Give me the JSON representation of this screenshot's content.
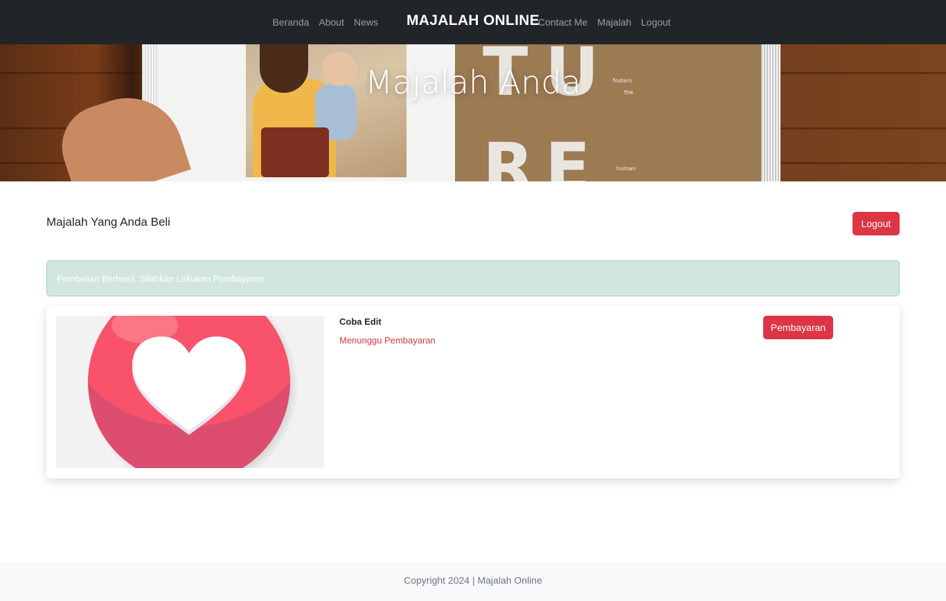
{
  "nav": {
    "left_links": [
      "Beranda",
      "About",
      "News"
    ],
    "brand": "MAJALAH ONLINE",
    "right_links": [
      "Contact Me",
      "Majalah",
      "Logout"
    ]
  },
  "hero": {
    "title": "Majalah Anda",
    "magazine_letters": [
      "T",
      "U",
      "R",
      "E"
    ],
    "magazine_words": [
      "fosters",
      "the",
      "human"
    ]
  },
  "main": {
    "section_title": "Majalah Yang Anda Beli",
    "logout_label": "Logout",
    "alert_text": "Pembelian Berhasil, Silahkan Lakukan Pembayaran",
    "card": {
      "title": "Coba Edit",
      "status": "Menunggu Pembayaran",
      "pay_label": "Pembayaran",
      "image_icon": "heart-icon"
    }
  },
  "footer": {
    "text": "Copyright 2024 | Majalah Online"
  },
  "colors": {
    "navbar": "#212529",
    "danger": "#dc3545",
    "alert_bg": "#d1e7dd",
    "footer_bg": "#f8f9fa"
  }
}
